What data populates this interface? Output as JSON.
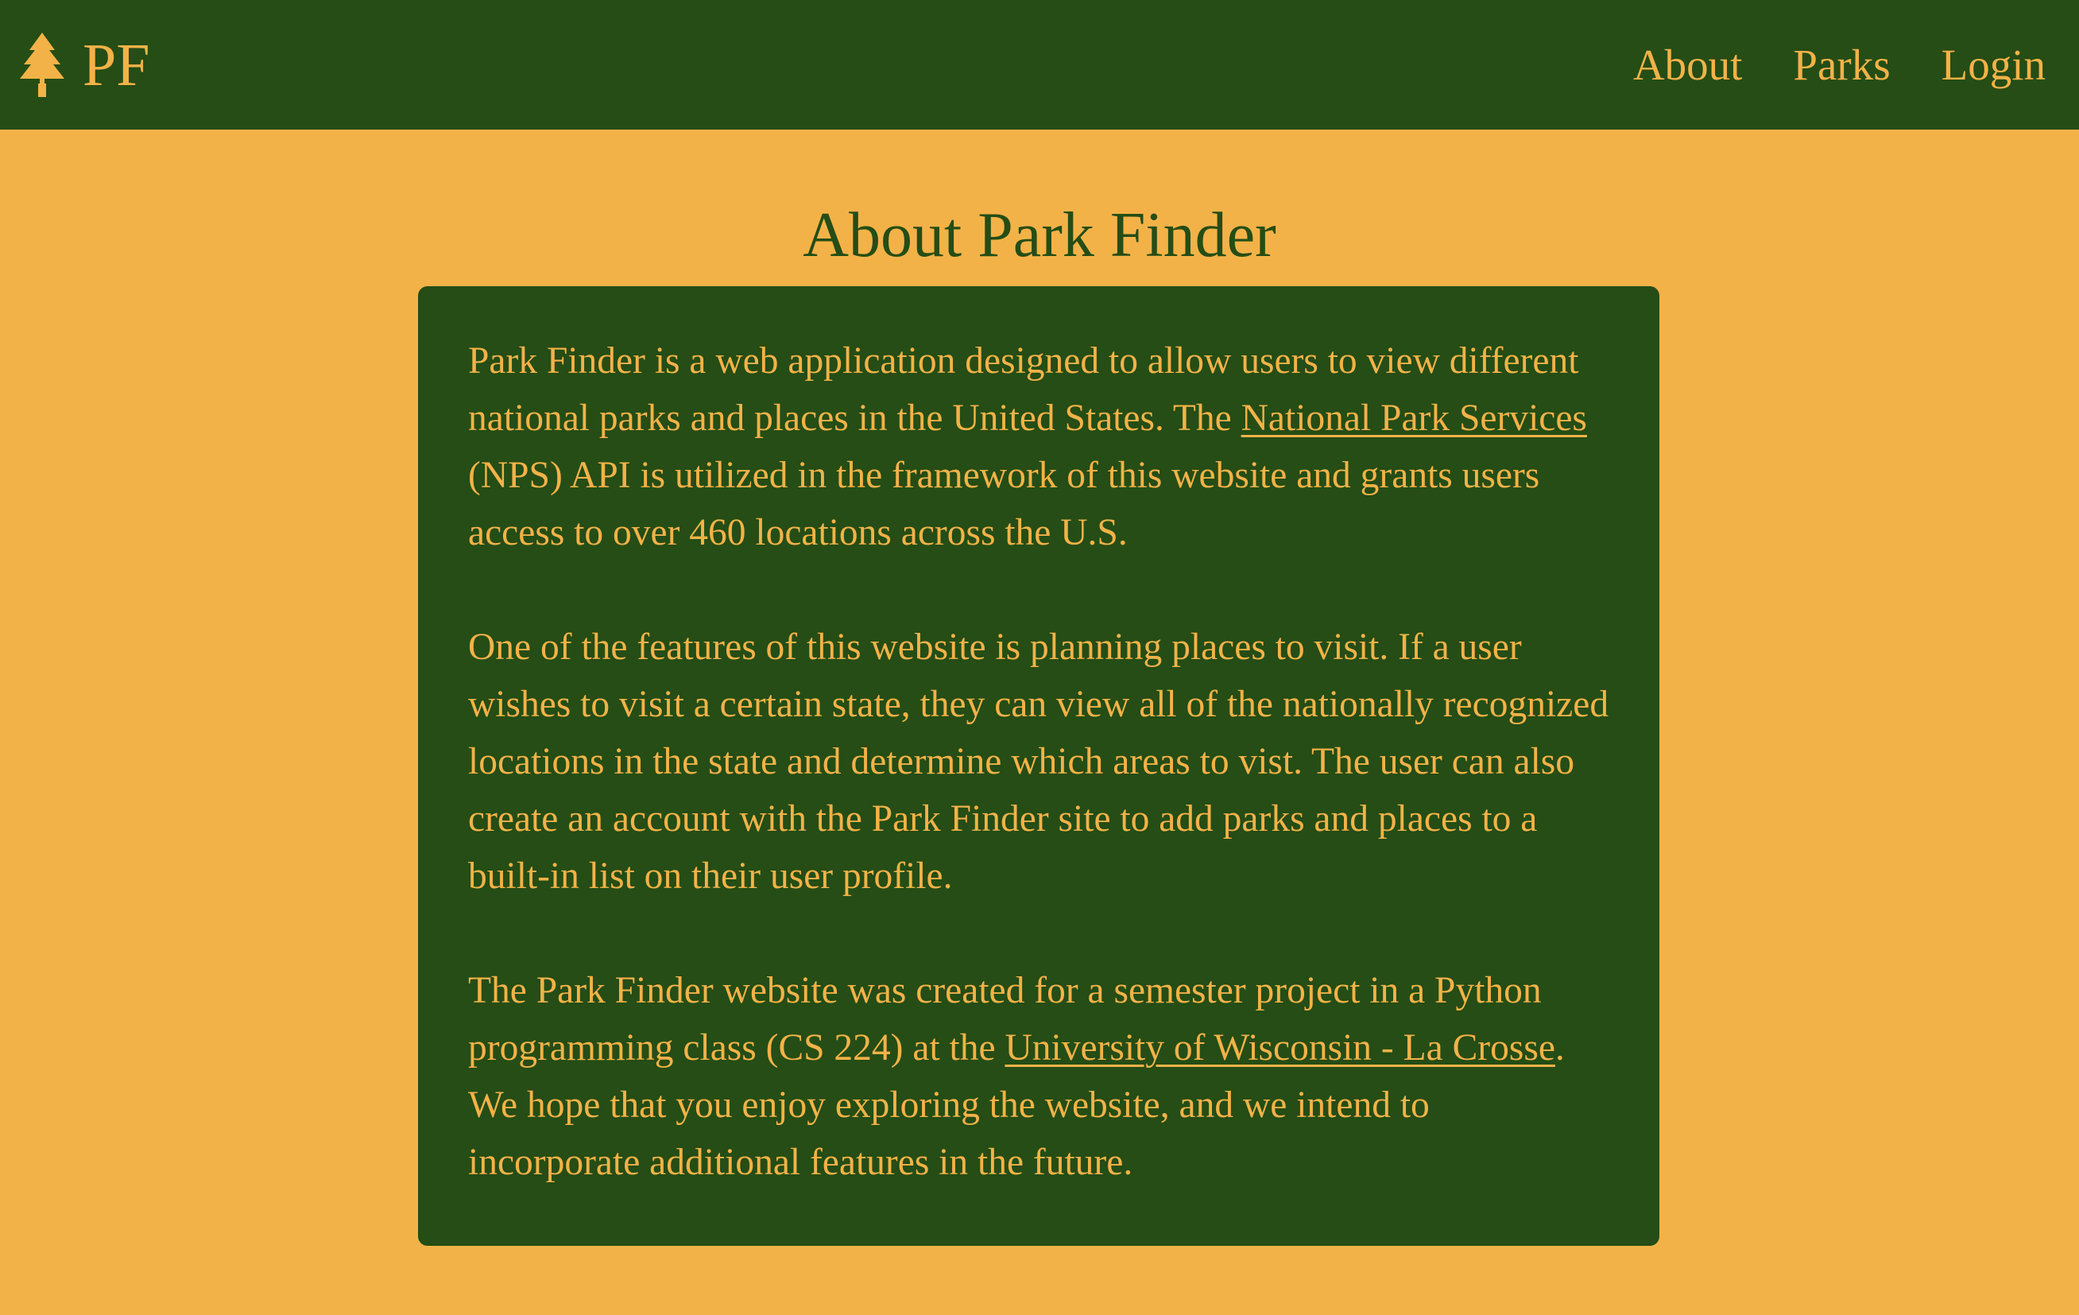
{
  "nav": {
    "brand": "PF",
    "links": [
      "About",
      "Parks",
      "Login"
    ]
  },
  "page": {
    "title": "About Park Finder"
  },
  "content": {
    "p1": {
      "before": "Park Finder is a web application designed to allow users to view different national parks and places in the United States. The ",
      "link": "National Park Services",
      "after": " (NPS) API is utilized in the framework of this website and grants users access to over 460 locations across the U.S."
    },
    "p2": "One of the features of this website is planning places to visit. If a user wishes to visit a certain state, they can view all of the nationally recognized locations in the state and determine which areas to vist. The user can also create an account with the Park Finder site to add parks and places to a built-in list on their user profile.",
    "p3": {
      "before": "The Park Finder website was created for a semester project in a Python programming class (CS 224) at the ",
      "link": "University of Wisconsin - La Crosse",
      "after": ". We hope that you enjoy exploring the website, and we intend to incorporate additional features in the future."
    }
  },
  "colors": {
    "background": "#F3B248",
    "primary": "#254D15",
    "text_on_primary": "#F3B248"
  },
  "icons": {
    "brand": "tree-icon"
  }
}
